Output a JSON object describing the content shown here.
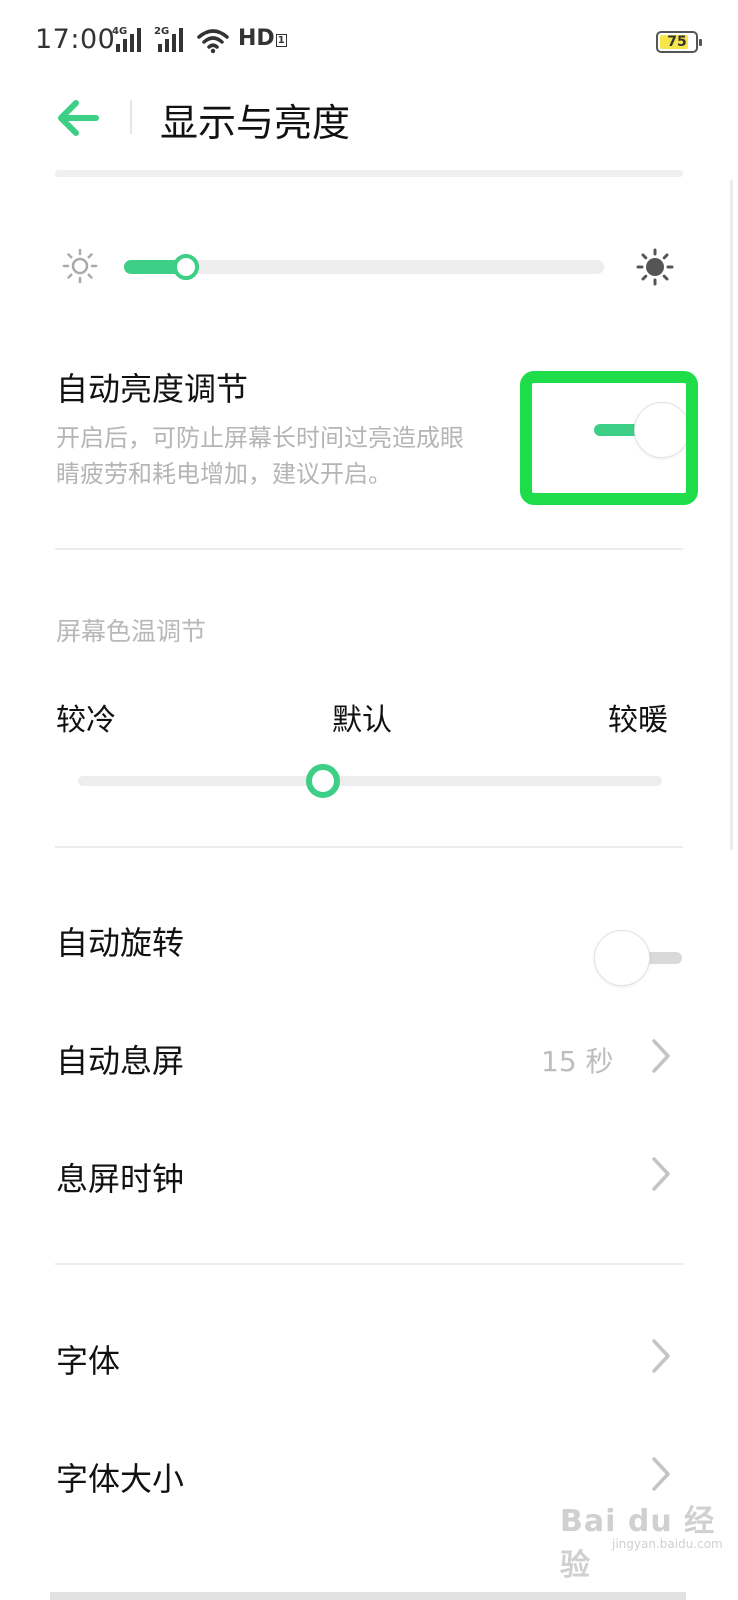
{
  "status_bar": {
    "time": "17:00",
    "signal1_label": "4G",
    "signal2_label": "2G",
    "hd_label": "HD",
    "hd_sub": "1",
    "battery": "75",
    "battery_color": "#f7e64b"
  },
  "header": {
    "title": "显示与亮度",
    "back_icon": "arrow-left-icon"
  },
  "brightness": {
    "level": 0.13,
    "min_icon": "sun-outline-icon",
    "max_icon": "sun-filled-icon"
  },
  "auto_brightness": {
    "title": "自动亮度调节",
    "description_line1": "开启后，可防止屏幕长时间过亮造成眼",
    "description_line2": "睛疲劳和耗电增加，建议开启。",
    "enabled": true
  },
  "color_temp": {
    "section_label": "屏幕色温调节",
    "cold_label": "较冷",
    "default_label": "默认",
    "warm_label": "较暖",
    "level": 0.42
  },
  "rows": {
    "auto_rotate": {
      "label": "自动旋转",
      "enabled": false
    },
    "screen_timeout": {
      "label": "自动息屏",
      "value": "15 秒"
    },
    "aod_clock": {
      "label": "息屏时钟"
    },
    "font": {
      "label": "字体"
    },
    "font_size": {
      "label": "字体大小"
    }
  },
  "watermark": {
    "text": "Bai du 经验",
    "sub": "jingyan.baidu.com"
  },
  "colors": {
    "accent": "#3dcf85",
    "highlight": "#1fdc4b"
  }
}
